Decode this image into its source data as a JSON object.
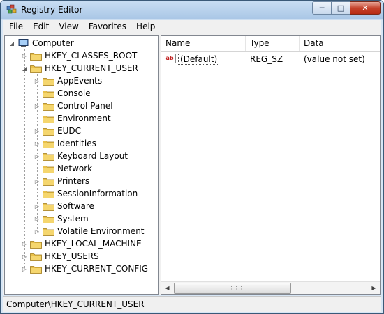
{
  "window": {
    "title": "Registry Editor"
  },
  "menu": [
    "File",
    "Edit",
    "View",
    "Favorites",
    "Help"
  ],
  "tree": {
    "root": "Computer",
    "hives": [
      {
        "label": "HKEY_CLASSES_ROOT",
        "expanded": false
      },
      {
        "label": "HKEY_CURRENT_USER",
        "expanded": true,
        "children": [
          {
            "label": "AppEvents",
            "has_children": true
          },
          {
            "label": "Console",
            "has_children": false
          },
          {
            "label": "Control Panel",
            "has_children": true
          },
          {
            "label": "Environment",
            "has_children": false
          },
          {
            "label": "EUDC",
            "has_children": true
          },
          {
            "label": "Identities",
            "has_children": true
          },
          {
            "label": "Keyboard Layout",
            "has_children": true
          },
          {
            "label": "Network",
            "has_children": false
          },
          {
            "label": "Printers",
            "has_children": true
          },
          {
            "label": "SessionInformation",
            "has_children": false
          },
          {
            "label": "Software",
            "has_children": true
          },
          {
            "label": "System",
            "has_children": true
          },
          {
            "label": "Volatile Environment",
            "has_children": true
          }
        ]
      },
      {
        "label": "HKEY_LOCAL_MACHINE",
        "expanded": false
      },
      {
        "label": "HKEY_USERS",
        "expanded": false
      },
      {
        "label": "HKEY_CURRENT_CONFIG",
        "expanded": false
      }
    ]
  },
  "list": {
    "columns": [
      "Name",
      "Type",
      "Data"
    ],
    "rows": [
      {
        "name": "(Default)",
        "type": "REG_SZ",
        "data": "(value not set)",
        "icon": "string-value-icon"
      }
    ]
  },
  "status": {
    "path": "Computer\\HKEY_CURRENT_USER"
  },
  "colors": {
    "folder": "#e8c04a",
    "accent": "#c6432c"
  }
}
